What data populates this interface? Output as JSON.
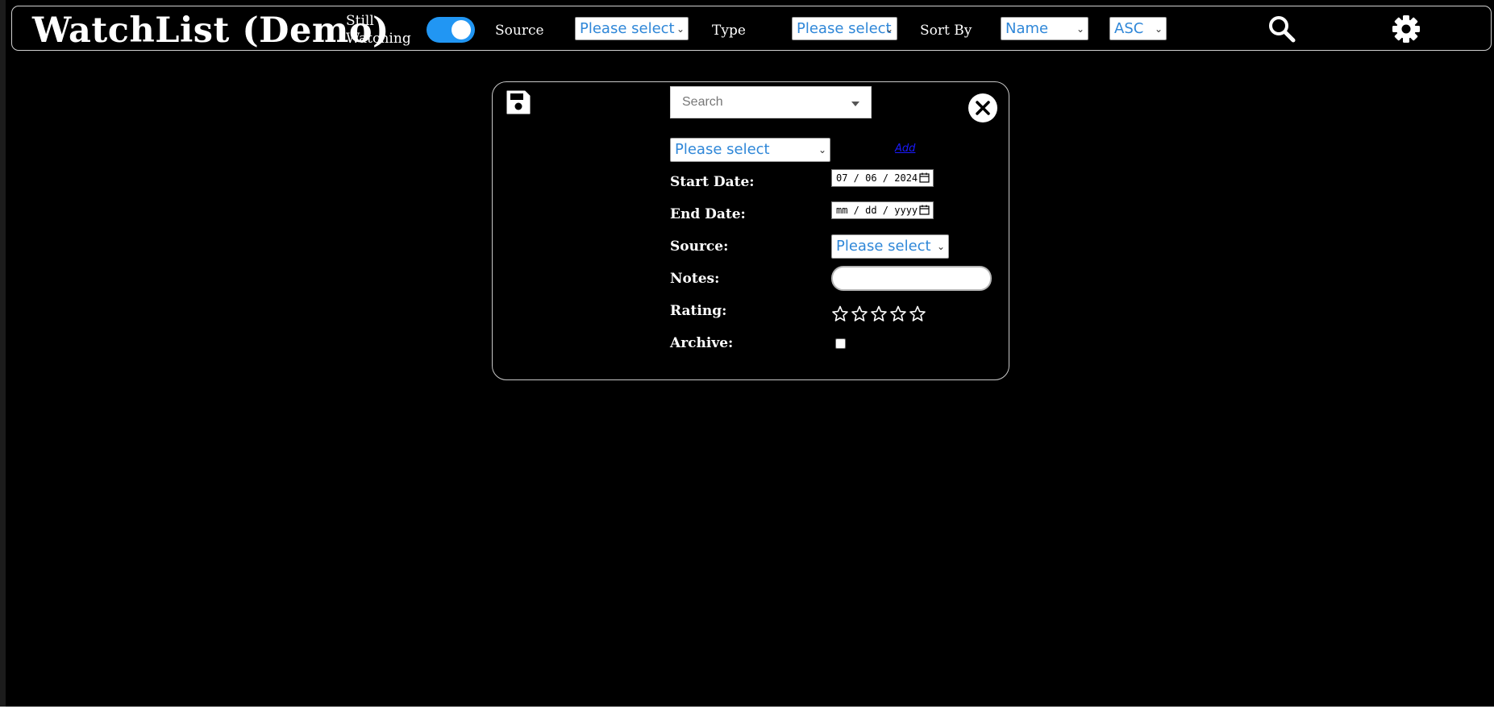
{
  "app": {
    "title": "WatchList (Demo)"
  },
  "toolbar": {
    "still_watching_label": "Still Watching",
    "still_watching_on": true,
    "source_label": "Source",
    "source_value": "Please select",
    "type_label": "Type",
    "type_value": "Please select",
    "sort_by_label": "Sort By",
    "sort_by_value": "Name",
    "order_value": "ASC",
    "search_icon": "search-icon",
    "settings_icon": "gear-icon"
  },
  "form": {
    "save_icon": "floppy-disk-icon",
    "close_icon": "close-icon",
    "search_placeholder": "Search",
    "title_select_value": "Please select",
    "add_link": "Add",
    "start_date_label": "Start Date:",
    "start_date_value": "07 / 06 / 2024",
    "end_date_label": "End Date:",
    "end_date_value": "mm / dd / yyyy",
    "source_label": "Source:",
    "source_value": "Please select",
    "notes_label": "Notes:",
    "notes_value": "",
    "rating_label": "Rating:",
    "rating_value": 0,
    "rating_max": 5,
    "archive_label": "Archive:",
    "archive_checked": false
  },
  "colors": {
    "accent": "#2196F3",
    "select_text": "#2f87d8",
    "background": "#000000",
    "link": "#1a1aff"
  }
}
